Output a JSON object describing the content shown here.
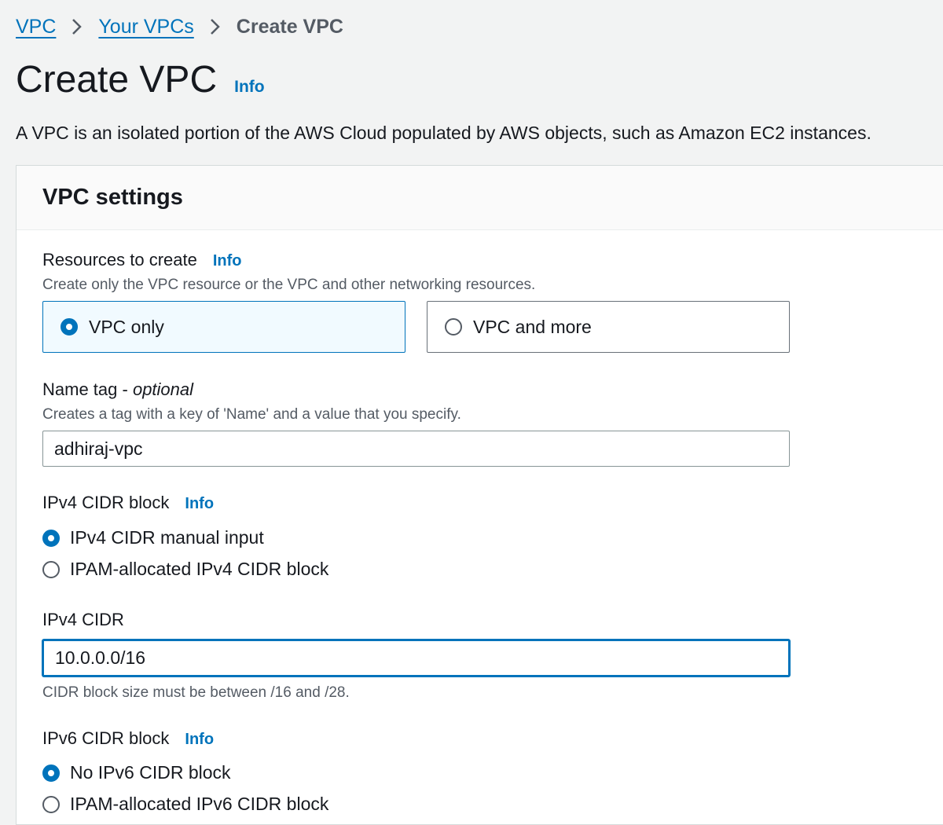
{
  "breadcrumb": {
    "items": [
      {
        "label": "VPC"
      },
      {
        "label": "Your VPCs"
      }
    ],
    "current": "Create VPC"
  },
  "page": {
    "title": "Create VPC",
    "info": "Info",
    "description": "A VPC is an isolated portion of the AWS Cloud populated by AWS objects, such as Amazon EC2 instances."
  },
  "vpc_settings": {
    "title": "VPC settings",
    "resources": {
      "label": "Resources to create",
      "info": "Info",
      "hint": "Create only the VPC resource or the VPC and other networking resources.",
      "options": [
        {
          "label": "VPC only",
          "selected": true
        },
        {
          "label": "VPC and more",
          "selected": false
        }
      ]
    },
    "name_tag": {
      "label": "Name tag",
      "separator": " - ",
      "optional": "optional",
      "hint": "Creates a tag with a key of 'Name' and a value that you specify.",
      "value": "adhiraj-vpc"
    },
    "ipv4_block": {
      "label": "IPv4 CIDR block",
      "info": "Info",
      "options": [
        {
          "label": "IPv4 CIDR manual input",
          "selected": true
        },
        {
          "label": "IPAM-allocated IPv4 CIDR block",
          "selected": false
        }
      ]
    },
    "ipv4_cidr": {
      "label": "IPv4 CIDR",
      "value": "10.0.0.0/16",
      "hint": "CIDR block size must be between /16 and /28."
    },
    "ipv6_block": {
      "label": "IPv6 CIDR block",
      "info": "Info",
      "options": [
        {
          "label": "No IPv6 CIDR block",
          "selected": true
        },
        {
          "label": "IPAM-allocated IPv6 CIDR block",
          "selected": false
        }
      ]
    }
  },
  "icons": {
    "separator": "chevron-right-icon",
    "radio_selected": "radio-checked-icon",
    "radio_unselected": "radio-unchecked-icon"
  },
  "colors": {
    "accent": "#0073bb",
    "selected_tile_bg": "#f1faff",
    "page_bg": "#f2f3f3"
  }
}
